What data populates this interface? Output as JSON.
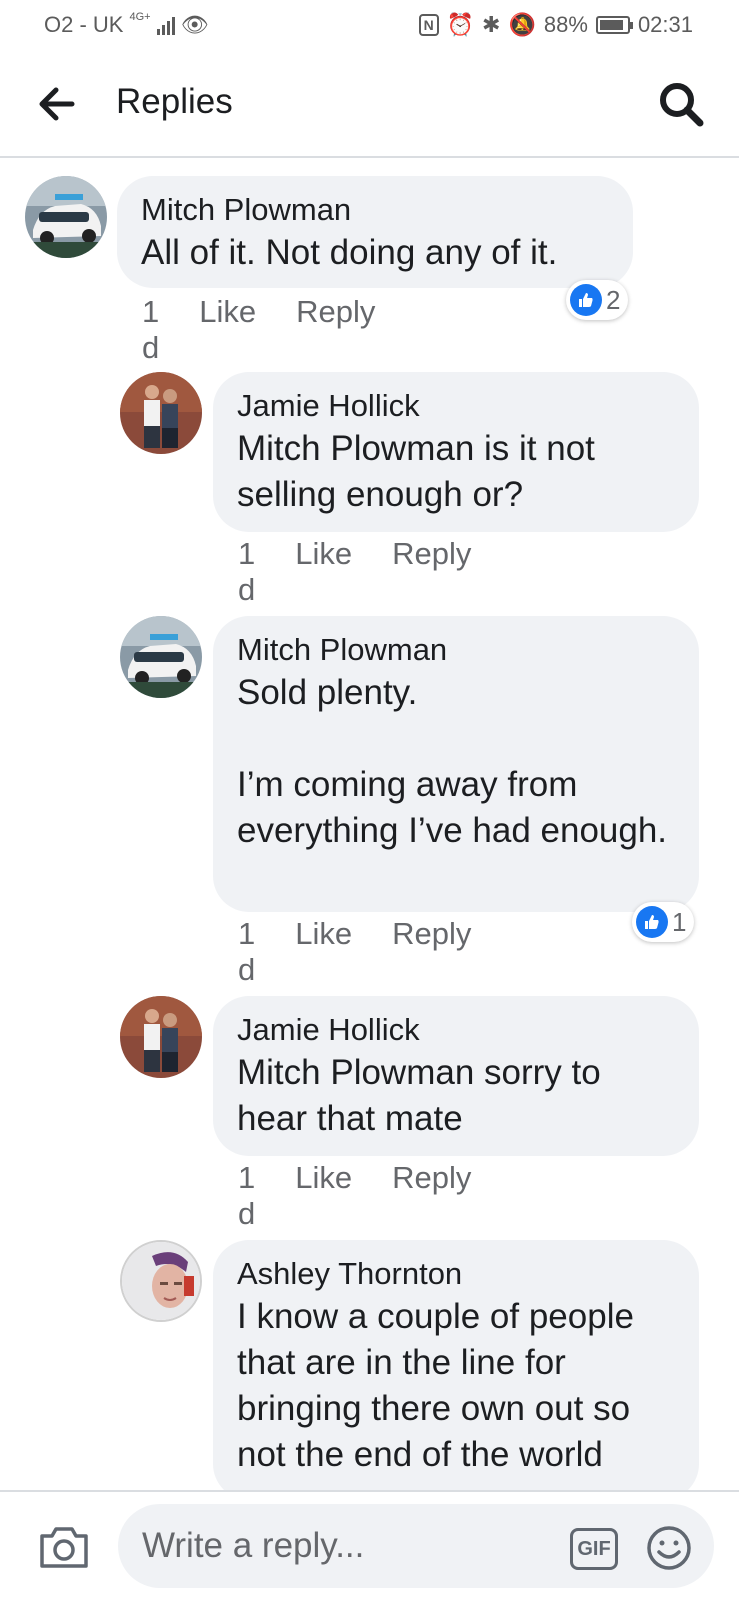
{
  "status_bar": {
    "carrier": "O2 - UK",
    "network": "4G+",
    "battery": "88%",
    "battery_level": 0.88,
    "time": "02:31"
  },
  "header": {
    "title": "Replies"
  },
  "comments": [
    {
      "author": "Mitch Plowman",
      "mention": "",
      "text": "All of it. Not doing any of it.",
      "time": "1 d",
      "like_label": "Like",
      "reply_label": "Reply",
      "reactions": "2"
    },
    {
      "author": "Jamie Hollick",
      "mention": "Mitch Plowman",
      "text": " is it not selling enough or?",
      "time": "1 d",
      "like_label": "Like",
      "reply_label": "Reply",
      "reactions": ""
    },
    {
      "author": "Mitch Plowman",
      "mention": "",
      "text": "Sold plenty.\n\nI’m coming away from everything I’ve had enough.",
      "time": "1 d",
      "like_label": "Like",
      "reply_label": "Reply",
      "reactions": "1"
    },
    {
      "author": "Jamie Hollick",
      "mention": "Mitch Plowman",
      "text": " sorry to hear that mate",
      "time": "1 d",
      "like_label": "Like",
      "reply_label": "Reply",
      "reactions": ""
    },
    {
      "author": "Ashley Thornton",
      "mention": "",
      "text": "I know a couple of people that are in the line for bringing there own out so not the end of the world",
      "time": "",
      "like_label": "",
      "reply_label": "",
      "reactions": ""
    }
  ],
  "composer": {
    "placeholder": "Write a reply...",
    "gif_label": "GIF"
  },
  "colors": {
    "bubble": "#f0f2f5",
    "like_blue": "#1877f2",
    "meta_gray": "#65676b",
    "divider": "#dadde1"
  }
}
